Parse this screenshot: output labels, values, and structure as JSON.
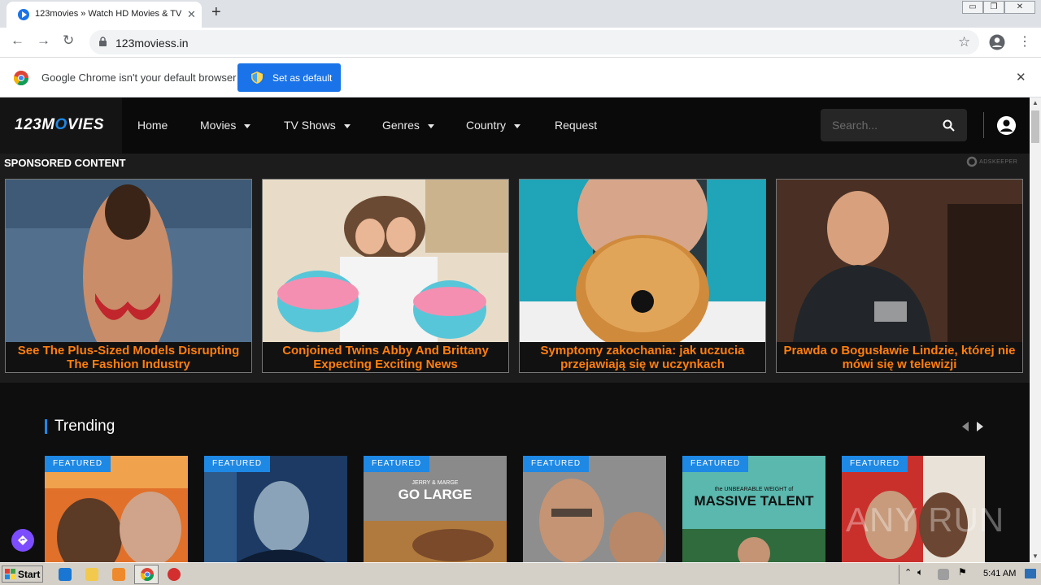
{
  "browser": {
    "tab_title": "123movies » Watch HD Movies & TV",
    "tab_close": "✕",
    "new_tab": "+",
    "url": "123moviess.in",
    "window_buttons": [
      "▭",
      "❐",
      "✕"
    ]
  },
  "infobar": {
    "text": "Google Chrome isn't your default browser",
    "button": "Set as default",
    "close": "✕"
  },
  "site": {
    "logo_left": "123M",
    "logo_o": "O",
    "logo_right": "VIES",
    "nav": [
      {
        "label": "Home",
        "has_caret": false
      },
      {
        "label": "Movies",
        "has_caret": true
      },
      {
        "label": "TV Shows",
        "has_caret": true
      },
      {
        "label": "Genres",
        "has_caret": true
      },
      {
        "label": "Country",
        "has_caret": true
      },
      {
        "label": "Request",
        "has_caret": false
      }
    ],
    "search_placeholder": "Search..."
  },
  "sponsored": {
    "title": "SPONSORED CONTENT",
    "provider": "ADSKEEPER",
    "cards": [
      {
        "caption": "See The Plus-Sized Models Disrupting The Fashion Industry"
      },
      {
        "caption": "Conjoined Twins Abby And Brittany Expecting Exciting News"
      },
      {
        "caption": "Symptomy zakochania: jak uczucia przejawiają się w uczynkach"
      },
      {
        "caption": "Prawda o Bogusławie Lindzie, której nie mówi się w telewizji"
      }
    ]
  },
  "trending": {
    "title": "Trending",
    "posters": [
      {
        "badge": "FEATURED",
        "art_text": ""
      },
      {
        "badge": "FEATURED",
        "art_text": ""
      },
      {
        "badge": "FEATURED",
        "art_text": "GO LARGE",
        "art_sub": "JERRY & MARGE"
      },
      {
        "badge": "FEATURED",
        "art_text": ""
      },
      {
        "badge": "FEATURED",
        "art_text": "MASSIVE TALENT",
        "art_sub": "the UNBEARABLE WEIGHT of"
      },
      {
        "badge": "FEATURED",
        "art_text": ""
      }
    ]
  },
  "watermark": "ANY RUN",
  "taskbar": {
    "start": "Start",
    "clock": "5:41 AM"
  },
  "colors": {
    "accent": "#1e88e5",
    "caption": "#ff7f0e",
    "header_bg": "#0a0a0a"
  }
}
